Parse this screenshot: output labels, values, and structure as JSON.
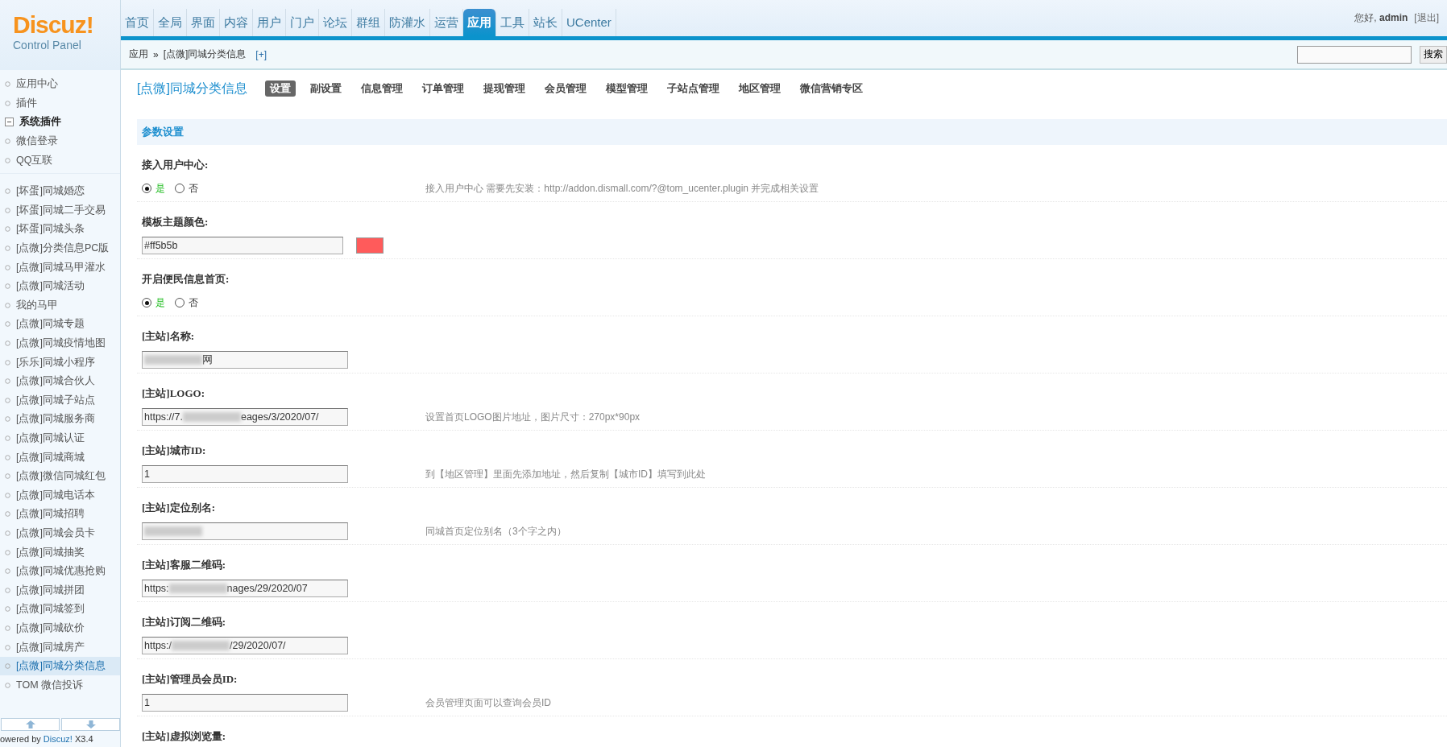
{
  "logo": {
    "name": "Discuz!",
    "subtitle": "Control Panel"
  },
  "nav": [
    {
      "label": "首页",
      "selected": false
    },
    {
      "label": "全局",
      "selected": false
    },
    {
      "label": "界面",
      "selected": false
    },
    {
      "label": "内容",
      "selected": false
    },
    {
      "label": "用户",
      "selected": false
    },
    {
      "label": "门户",
      "selected": false
    },
    {
      "label": "论坛",
      "selected": false
    },
    {
      "label": "群组",
      "selected": false
    },
    {
      "label": "防灌水",
      "selected": false
    },
    {
      "label": "运营",
      "selected": false
    },
    {
      "label": "应用",
      "selected": true
    },
    {
      "label": "工具",
      "selected": false
    },
    {
      "label": "站长",
      "selected": false
    },
    {
      "label": "UCenter",
      "selected": false
    }
  ],
  "user": {
    "greeting": "您好,",
    "name": "admin",
    "logout": "[退出]"
  },
  "breadcrumb": {
    "items": [
      "应用",
      "[点微]同城分类信息"
    ],
    "separator": "»",
    "add": "[+]"
  },
  "search": {
    "button": "搜索"
  },
  "sidebar": {
    "items": [
      {
        "kind": "item",
        "label": "应用中心",
        "selected": false
      },
      {
        "kind": "item",
        "label": "插件",
        "selected": false
      },
      {
        "kind": "group",
        "label": "系统插件",
        "selected": false
      },
      {
        "kind": "item",
        "label": "微信登录",
        "selected": false
      },
      {
        "kind": "item",
        "label": "QQ互联",
        "selected": false
      },
      {
        "kind": "gap"
      },
      {
        "kind": "item",
        "label": "[坏蛋]同城婚恋",
        "selected": false
      },
      {
        "kind": "item",
        "label": "[坏蛋]同城二手交易",
        "selected": false
      },
      {
        "kind": "item",
        "label": "[坏蛋]同城头条",
        "selected": false
      },
      {
        "kind": "item",
        "label": "[点微]分类信息PC版",
        "selected": false
      },
      {
        "kind": "item",
        "label": "[点微]同城马甲灌水",
        "selected": false
      },
      {
        "kind": "item",
        "label": "[点微]同城活动",
        "selected": false
      },
      {
        "kind": "item",
        "label": "我的马甲",
        "selected": false
      },
      {
        "kind": "item",
        "label": "[点微]同城专题",
        "selected": false
      },
      {
        "kind": "item",
        "label": "[点微]同城疫情地图",
        "selected": false
      },
      {
        "kind": "item",
        "label": "[乐乐]同城小程序",
        "selected": false
      },
      {
        "kind": "item",
        "label": "[点微]同城合伙人",
        "selected": false
      },
      {
        "kind": "item",
        "label": "[点微]同城子站点",
        "selected": false
      },
      {
        "kind": "item",
        "label": "[点微]同城服务商",
        "selected": false
      },
      {
        "kind": "item",
        "label": "[点微]同城认证",
        "selected": false
      },
      {
        "kind": "item",
        "label": "[点微]同城商城",
        "selected": false
      },
      {
        "kind": "item",
        "label": "[点微]微信同城红包",
        "selected": false
      },
      {
        "kind": "item",
        "label": "[点微]同城电话本",
        "selected": false
      },
      {
        "kind": "item",
        "label": "[点微]同城招聘",
        "selected": false
      },
      {
        "kind": "item",
        "label": "[点微]同城会员卡",
        "selected": false
      },
      {
        "kind": "item",
        "label": "[点微]同城抽奖",
        "selected": false
      },
      {
        "kind": "item",
        "label": "[点微]同城优惠抢购",
        "selected": false
      },
      {
        "kind": "item",
        "label": "[点微]同城拼团",
        "selected": false
      },
      {
        "kind": "item",
        "label": "[点微]同城签到",
        "selected": false
      },
      {
        "kind": "item",
        "label": "[点微]同城砍价",
        "selected": false
      },
      {
        "kind": "item",
        "label": "[点微]同城房产",
        "selected": false
      },
      {
        "kind": "item",
        "label": "[点微]同城分类信息",
        "selected": true
      },
      {
        "kind": "item",
        "label": "TOM 微信投诉",
        "selected": false
      }
    ]
  },
  "footer": {
    "prefix": "owered by",
    "brand": "Discuz!",
    "version": "X3.4"
  },
  "page": {
    "title": "[点微]同城分类信息",
    "tabs": [
      {
        "label": "设置",
        "selected": true
      },
      {
        "label": "副设置",
        "selected": false
      },
      {
        "label": "信息管理",
        "selected": false
      },
      {
        "label": "订单管理",
        "selected": false
      },
      {
        "label": "提现管理",
        "selected": false
      },
      {
        "label": "会员管理",
        "selected": false
      },
      {
        "label": "模型管理",
        "selected": false
      },
      {
        "label": "子站点管理",
        "selected": false
      },
      {
        "label": "地区管理",
        "selected": false
      },
      {
        "label": "微信营销专区",
        "selected": false
      }
    ],
    "section": "参数设置",
    "settings": [
      {
        "kind": "radio",
        "label": "接入用户中心:",
        "options": [
          {
            "label": "是",
            "selected": true
          },
          {
            "label": "否",
            "selected": false
          }
        ],
        "hint": "接入用户中心 需要先安装：http://addon.dismall.com/?@tom_ucenter.plugin 并完成相关设置"
      },
      {
        "kind": "color",
        "label": "模板主题颜色:",
        "segments": [
          {
            "kind": "text",
            "text": "#ff5b5b"
          }
        ],
        "color": "#ff5b5b"
      },
      {
        "kind": "radio",
        "label": "开启便民信息首页:",
        "options": [
          {
            "label": "是",
            "selected": true
          },
          {
            "label": "否",
            "selected": false
          }
        ]
      },
      {
        "kind": "text",
        "label": "[主站]名称:",
        "segments": [
          {
            "kind": "blur"
          },
          {
            "kind": "text",
            "text": "网"
          }
        ]
      },
      {
        "kind": "text",
        "label": "[主站]LOGO:",
        "segments": [
          {
            "kind": "text",
            "text": "https://7."
          },
          {
            "kind": "blur"
          },
          {
            "kind": "text",
            "text": "eages/3/2020/07/"
          }
        ],
        "hint": "设置首页LOGO图片地址，图片尺寸：270px*90px"
      },
      {
        "kind": "text",
        "label": "[主站]城市ID:",
        "segments": [
          {
            "kind": "text",
            "text": "1"
          }
        ],
        "hint": "到【地区管理】里面先添加地址，然后复制【城市ID】填写到此处"
      },
      {
        "kind": "text",
        "label": "[主站]定位别名:",
        "segments": [
          {
            "kind": "blur"
          }
        ],
        "hint": "同城首页定位别名（3个字之内）"
      },
      {
        "kind": "text",
        "label": "[主站]客服二维码:",
        "segments": [
          {
            "kind": "text",
            "text": "https:"
          },
          {
            "kind": "blur"
          },
          {
            "kind": "text",
            "text": "nages/29/2020/07"
          }
        ]
      },
      {
        "kind": "text",
        "label": "[主站]订阅二维码:",
        "segments": [
          {
            "kind": "text",
            "text": "https:/"
          },
          {
            "kind": "blur"
          },
          {
            "kind": "text",
            "text": "/29/2020/07/"
          }
        ]
      },
      {
        "kind": "text",
        "label": "[主站]管理员会员ID:",
        "segments": [
          {
            "kind": "text",
            "text": "1"
          }
        ],
        "hint": "会员管理页面可以查询会员ID"
      },
      {
        "kind": "label_only",
        "label": "[主站]虚拟浏览量:"
      }
    ]
  }
}
